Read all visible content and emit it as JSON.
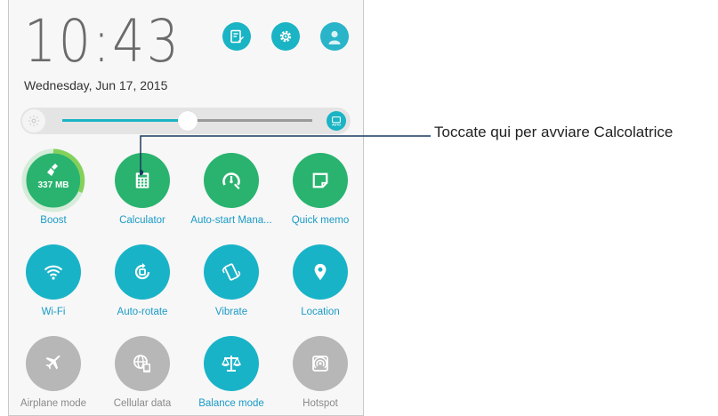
{
  "status": {
    "time": "10:43",
    "date": "Wednesday, Jun 17, 2015"
  },
  "header_icons": [
    {
      "name": "edit-icon"
    },
    {
      "name": "settings-icon"
    },
    {
      "name": "user-avatar-icon"
    }
  ],
  "brightness": {
    "level_percent": 50,
    "auto_label": "AUTO"
  },
  "quick_settings": [
    {
      "label": "Boost",
      "badge": "337 MB",
      "state": "green"
    },
    {
      "label": "Calculator",
      "state": "green"
    },
    {
      "label": "Auto-start Mana...",
      "state": "green"
    },
    {
      "label": "Quick memo",
      "state": "green"
    },
    {
      "label": "Wi-Fi",
      "state": "on"
    },
    {
      "label": "Auto-rotate",
      "state": "on"
    },
    {
      "label": "Vibrate",
      "state": "on"
    },
    {
      "label": "Location",
      "state": "on"
    },
    {
      "label": "Airplane mode",
      "state": "off"
    },
    {
      "label": "Cellular data",
      "state": "off"
    },
    {
      "label": "Balance mode",
      "state": "on"
    },
    {
      "label": "Hotspot",
      "state": "off"
    }
  ],
  "callout": {
    "text": "Toccate qui per avviare Calcolatrice"
  },
  "colors": {
    "accent": "#1ab4c4",
    "green": "#2ab36f",
    "disabled": "#b7b7b7"
  }
}
